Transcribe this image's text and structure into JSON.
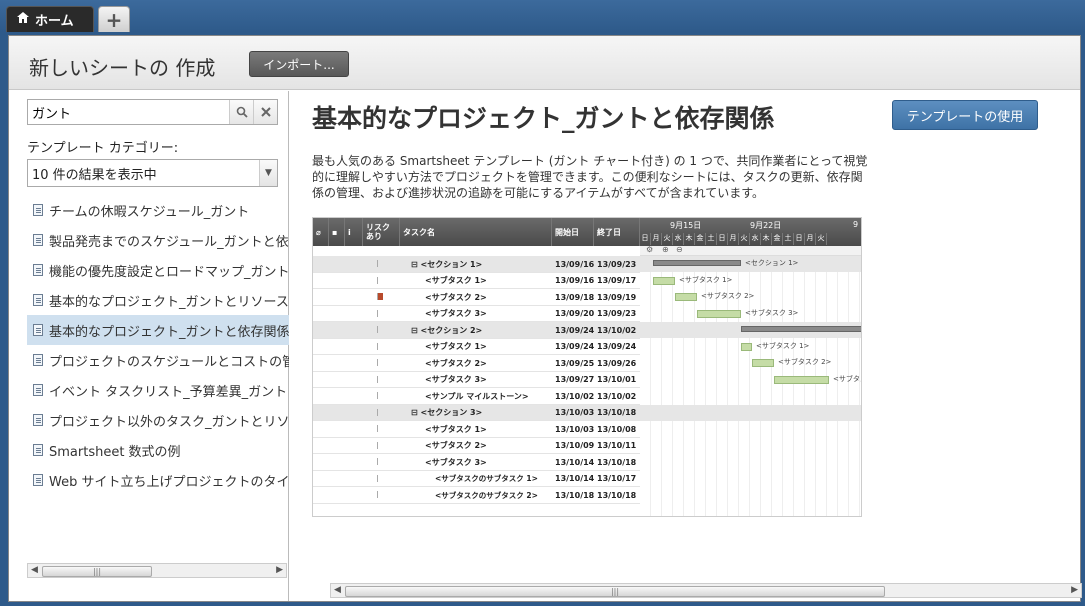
{
  "tabs": {
    "home_label": "ホーム",
    "add_label": "+"
  },
  "header": {
    "title": "新しいシートの 作成",
    "import_label": "インポート..."
  },
  "search": {
    "value": "ガント"
  },
  "category": {
    "label": "テンプレート カテゴリー:",
    "selected": "10 件の結果を表示中"
  },
  "templates": [
    "チームの休暇スケジュール_ガント",
    "製品発売までのスケジュール_ガントと依存関係",
    "機能の優先度設定とロードマップ_ガント",
    "基本的なプロジェクト_ガントとリソース管理",
    "基本的なプロジェクト_ガントと依存関係",
    "プロジェクトのスケジュールとコストの管理",
    "イベント タスクリスト_予算差異_ガント",
    "プロジェクト以外のタスク_ガントとリソース",
    "Smartsheet 数式の例",
    "Web サイト立ち上げプロジェクトのタイムライン"
  ],
  "detail": {
    "title": "基本的なプロジェクト_ガントと依存関係",
    "use_label": "テンプレートの使用",
    "description": "最も人気のある Smartsheet テンプレート (ガント チャート付き) の 1 つで、共同作業者にとって視覚的に理解しやすい方法でプロジェクトを管理できます。この便利なシートには、タスクの更新、依存関係の管理、および進捗状況の追跡を可能にするアイテムがすべてが含まれています。"
  },
  "gantt": {
    "headers": {
      "risk": "リスク あり",
      "task": "タスク名",
      "start": "開始日",
      "end": "終了日"
    },
    "weeks": [
      "9月15日",
      "9月22日",
      "9"
    ],
    "days": [
      "日",
      "月",
      "火",
      "水",
      "木",
      "金",
      "土",
      "日",
      "月",
      "火",
      "水",
      "木",
      "金",
      "土",
      "日",
      "月",
      "火"
    ],
    "rows": [
      {
        "name": "<セクション 1>",
        "start": "13/09/16",
        "end": "13/09/23",
        "section": true
      },
      {
        "name": "<サブタスク 1>",
        "start": "13/09/16",
        "end": "13/09/17"
      },
      {
        "name": "<サブタスク 2>",
        "start": "13/09/18",
        "end": "13/09/19"
      },
      {
        "name": "<サブタスク 3>",
        "start": "13/09/20",
        "end": "13/09/23"
      },
      {
        "name": "<セクション 2>",
        "start": "13/09/24",
        "end": "13/10/02",
        "section": true
      },
      {
        "name": "<サブタスク 1>",
        "start": "13/09/24",
        "end": "13/09/24"
      },
      {
        "name": "<サブタスク 2>",
        "start": "13/09/25",
        "end": "13/09/26"
      },
      {
        "name": "<サブタスク 3>",
        "start": "13/09/27",
        "end": "13/10/01"
      },
      {
        "name": "<サンプル マイルストーン>",
        "start": "13/10/02",
        "end": "13/10/02"
      },
      {
        "name": "<セクション 3>",
        "start": "13/10/03",
        "end": "13/10/18",
        "section": true
      },
      {
        "name": "<サブタスク 1>",
        "start": "13/10/03",
        "end": "13/10/08"
      },
      {
        "name": "<サブタスク 2>",
        "start": "13/10/09",
        "end": "13/10/11"
      },
      {
        "name": "<サブタスク 3>",
        "start": "13/10/14",
        "end": "13/10/18"
      },
      {
        "name": "<サブタスクのサブタスク 1>",
        "start": "13/10/14",
        "end": "13/10/17"
      },
      {
        "name": "<サブタスクのサブタスク 2>",
        "start": "13/10/18",
        "end": "13/10/18"
      }
    ],
    "bar_labels": [
      "<セクション 1>",
      "<サブタスク 1>",
      "<サブタスク 2>",
      "<サブタスク 3>",
      "<サブタスク 1>",
      "<サブタスク 2>",
      "<サブタスク 3>"
    ]
  }
}
